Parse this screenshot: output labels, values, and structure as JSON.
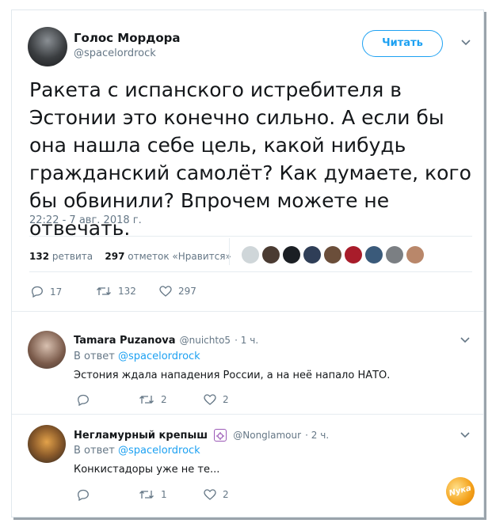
{
  "main_tweet": {
    "author_name": "Голос Мордора",
    "author_handle": "@spacelordrock",
    "follow_label": "Читать",
    "text": "Ракета с испанского истребителя в Эстонии это конечно сильно. А если бы она нашла себе цель, какой нибудь гражданский самолёт? Как думаете, кого бы обвинили? Впрочем можете не отвечать.",
    "timestamp": "22:22 - 7 авг. 2018 г.",
    "retweets_count": "132",
    "retweets_label": "ретвита",
    "likes_count": "297",
    "likes_label": "отметок «Нравится»",
    "actions": {
      "replies": "17",
      "retweets": "132",
      "likes": "297"
    }
  },
  "replies": [
    {
      "author_name": "Tamara Puzanova",
      "author_handle": "@nuichto5",
      "time": "· 1 ч.",
      "in_reply_prefix": "В ответ",
      "in_reply_handle": "@spacelordrock",
      "text": "Эстония ждала нападения России, а на неё напало НАТО.",
      "actions": {
        "replies": "",
        "retweets": "2",
        "likes": "2"
      }
    },
    {
      "author_name": "Негламурный крепыш",
      "author_handle": "@Nonglamour",
      "time": "· 2 ч.",
      "in_reply_prefix": "В ответ",
      "in_reply_handle": "@spacelordrock",
      "text": "Конкистадоры уже не те...",
      "actions": {
        "replies": "",
        "retweets": "1",
        "likes": "2"
      }
    }
  ],
  "watermark_text": "Nука",
  "colors": {
    "accent": "#1da1f2",
    "muted": "#657786",
    "text": "#14171a",
    "divider": "#e6ecf0"
  },
  "icons": [
    "reply-icon",
    "retweet-icon",
    "like-icon",
    "chevron-down-icon",
    "badge-icon"
  ]
}
